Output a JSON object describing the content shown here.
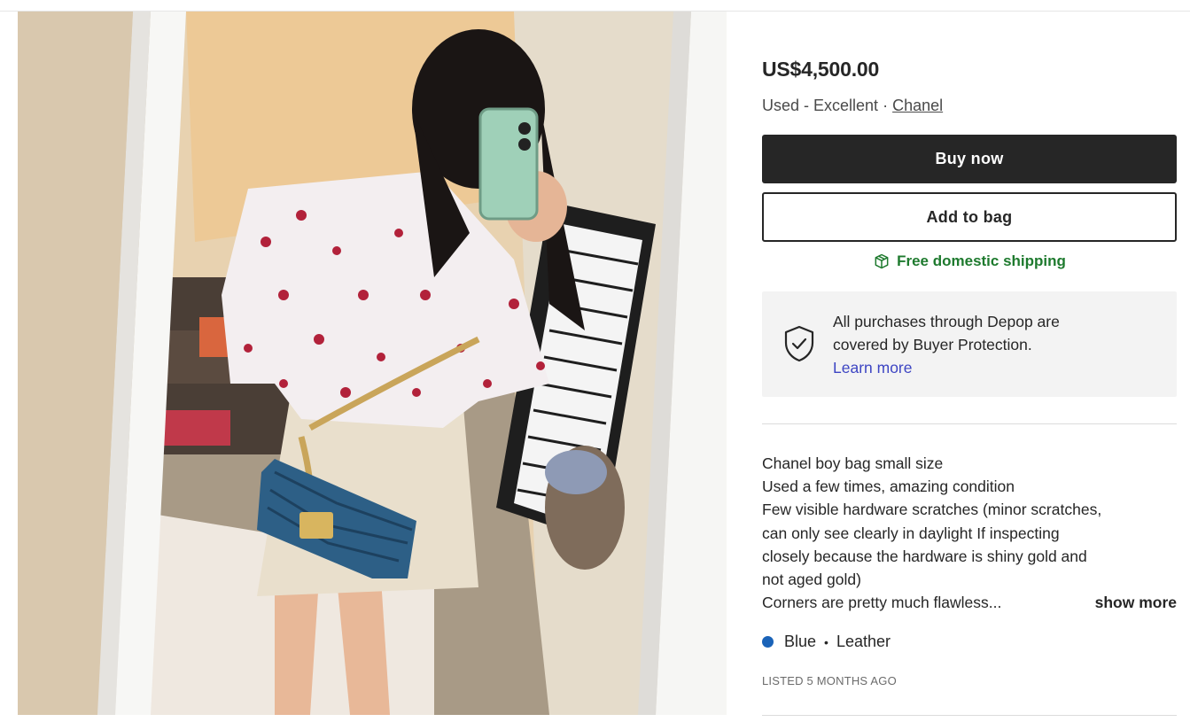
{
  "product": {
    "price": "US$4,500.00",
    "condition": "Used - Excellent",
    "meta_separator": "·",
    "brand": "Chanel"
  },
  "actions": {
    "buy_now": "Buy now",
    "add_to_bag": "Add to bag"
  },
  "shipping": {
    "label": "Free domestic shipping",
    "icon": "box-icon",
    "color": "#1e7a2e"
  },
  "buyer_protection": {
    "line1": "All purchases through Depop are",
    "line2": "covered by Buyer Protection.",
    "link": "Learn more",
    "icon": "shield-check-icon"
  },
  "description": {
    "lines": [
      "Chanel boy bag small size",
      "Used a few times, amazing condition",
      "Few visible hardware scratches (minor scratches,",
      "can only see clearly in daylight If inspecting",
      "closely because the hardware is shiny gold and",
      "not aged gold)",
      "Corners are pretty much flawless..."
    ],
    "show_more": "show more"
  },
  "attributes": {
    "color_name": "Blue",
    "color_swatch": "#1a63b8",
    "separator": "•",
    "material": "Leather"
  },
  "listed": "LISTED 5 MONTHS AGO"
}
